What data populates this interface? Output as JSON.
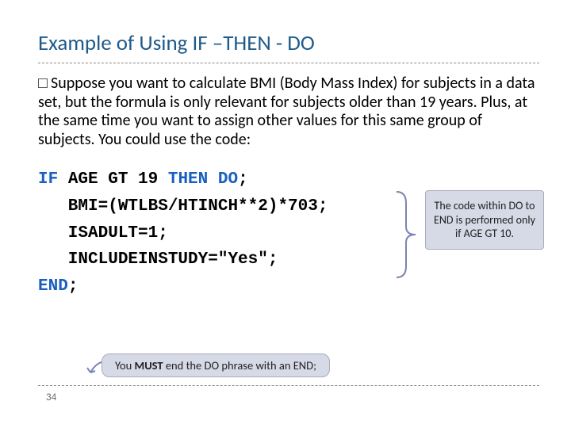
{
  "title": "Example of Using IF –THEN - DO",
  "paragraph": "Suppose you want to calculate BMI (Body Mass Index) for subjects in a data set, but the formula is only relevant for subjects older than 19 years. Plus, at the same time you want to assign other values for this same group of subjects. You could use the code:",
  "code": {
    "kw_if": "IF",
    "l1_mid": " AGE GT 19 ",
    "kw_then": "THEN",
    "kw_do": "DO",
    "l1_end": ";",
    "l2": "   BMI=(WTLBS/HTINCH**2)*703;",
    "l3": "   ISADULT=1;",
    "l4": "   INCLUDEINSTUDY=\"Yes\";",
    "kw_end": "END",
    "l5_end": ";"
  },
  "callout": "The code within DO to END is performed only if AGE GT 10.",
  "end_note_pre": "You ",
  "end_note_bold": "MUST",
  "end_note_post": " end the DO phrase with an END;",
  "page_number": "34"
}
